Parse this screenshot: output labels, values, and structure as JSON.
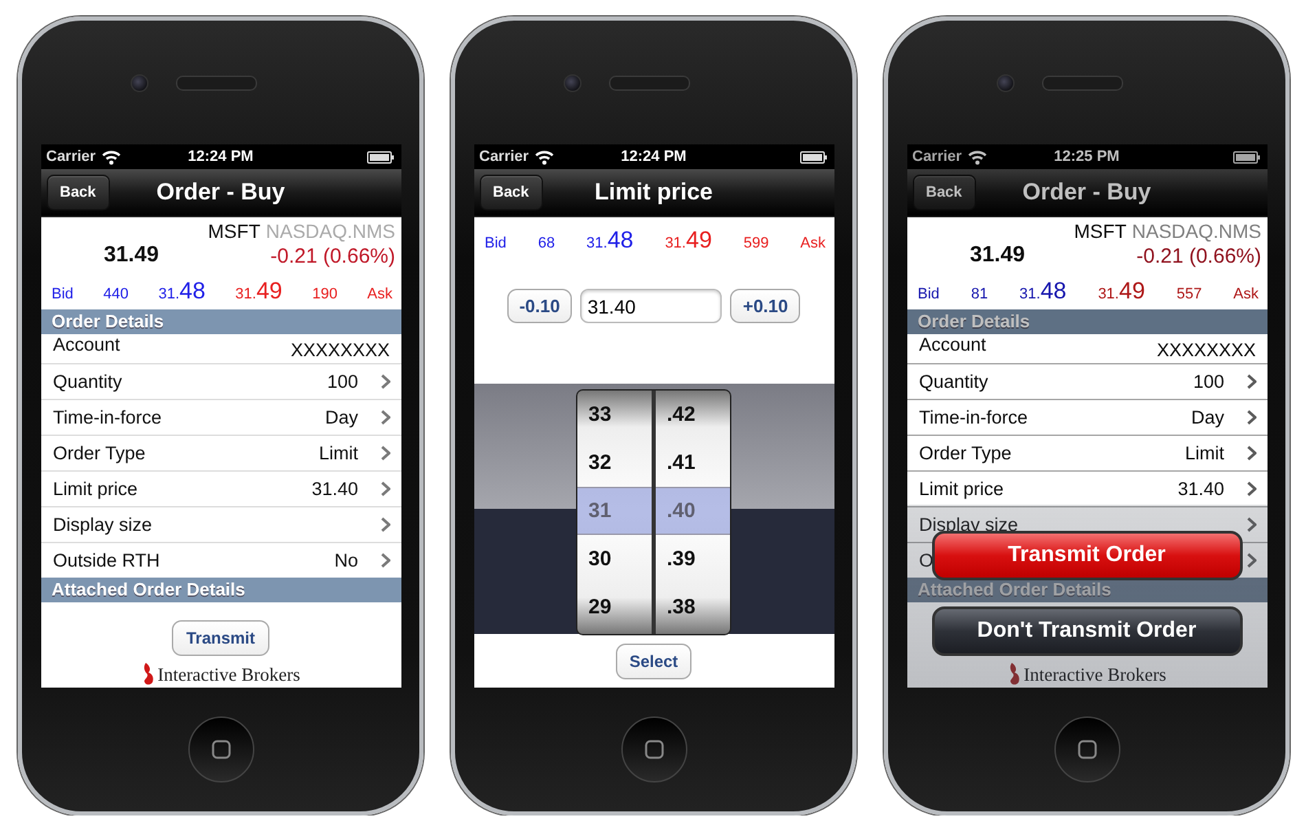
{
  "phones": [
    {
      "kind": "order",
      "dimmed": false,
      "status": {
        "carrier": "Carrier",
        "time": "12:24 PM"
      },
      "nav": {
        "back": "Back",
        "title": "Order - Buy"
      },
      "quote": {
        "symbol": "MSFT",
        "exchange": "NASDAQ.NMS",
        "last": "31.49",
        "change": "-0.21 (0.66%)",
        "bid_label": "Bid",
        "bid_size": "440",
        "bid_price": {
          "main": "31.",
          "big": "48"
        },
        "ask_price": {
          "main": "31.",
          "big": "49"
        },
        "ask_size": "190",
        "ask_label": "Ask"
      },
      "sections": [
        {
          "title": "Order Details",
          "rows": [
            {
              "label": "Account",
              "value": "XXXXXXXX",
              "disclosure": false
            },
            {
              "label": "Quantity",
              "value": "100",
              "disclosure": true
            },
            {
              "label": "Time-in-force",
              "value": "Day",
              "disclosure": true
            },
            {
              "label": "Order Type",
              "value": "Limit",
              "disclosure": true
            },
            {
              "label": "Limit price",
              "value": "31.40",
              "disclosure": true
            },
            {
              "label": "Display size",
              "disclosure": true
            },
            {
              "label": "Outside RTH",
              "value": "No",
              "disclosure": true
            }
          ]
        },
        {
          "title": "Attached Order Details"
        }
      ],
      "button": "Transmit",
      "logo": "Interactive Brokers"
    },
    {
      "kind": "picker",
      "dimmed": false,
      "status": {
        "carrier": "Carrier",
        "time": "12:24 PM"
      },
      "nav": {
        "back": "Back",
        "title": "Limit price"
      },
      "quote": {
        "bid_label": "Bid",
        "bid_size": "68",
        "bid_price": {
          "main": "31.",
          "big": "48"
        },
        "ask_price": {
          "main": "31.",
          "big": "49"
        },
        "ask_size": "599",
        "ask_label": "Ask"
      },
      "stepper": {
        "decrement": "-0.10",
        "value": "31.40",
        "increment": "+0.10"
      },
      "picker": {
        "columns": [
          {
            "items": [
              {
                "text": "33",
                "selected": false
              },
              {
                "text": "32",
                "selected": false
              },
              {
                "text": "31",
                "selected": true
              },
              {
                "text": "30",
                "selected": false
              },
              {
                "text": "29",
                "selected": false
              }
            ]
          },
          {
            "items": [
              {
                "text": ".42",
                "selected": false
              },
              {
                "text": ".41",
                "selected": false
              },
              {
                "text": ".40",
                "selected": true
              },
              {
                "text": ".39",
                "selected": false
              },
              {
                "text": ".38",
                "selected": false
              }
            ]
          }
        ]
      },
      "button": "Select"
    },
    {
      "kind": "order",
      "dimmed": true,
      "status": {
        "carrier": "Carrier",
        "time": "12:25 PM"
      },
      "nav": {
        "back": "Back",
        "title": "Order - Buy"
      },
      "quote": {
        "symbol": "MSFT",
        "exchange": "NASDAQ.NMS",
        "last": "31.49",
        "change": "-0.21 (0.66%)",
        "bid_label": "Bid",
        "bid_size": "81",
        "bid_price": {
          "main": "31.",
          "big": "48"
        },
        "ask_price": {
          "main": "31.",
          "big": "49"
        },
        "ask_size": "557",
        "ask_label": "Ask"
      },
      "sections": [
        {
          "title": "Order Details",
          "rows": [
            {
              "label": "Account",
              "value": "XXXXXXXX",
              "disclosure": false
            },
            {
              "label": "Quantity",
              "value": "100",
              "disclosure": true
            },
            {
              "label": "Time-in-force",
              "value": "Day",
              "disclosure": true
            },
            {
              "label": "Order Type",
              "value": "Limit",
              "disclosure": true
            },
            {
              "label": "Limit price",
              "value": "31.40",
              "disclosure": true
            },
            {
              "label": "Display size",
              "disclosure": true
            },
            {
              "label": "O",
              "disclosure": true
            }
          ]
        },
        {
          "title": "Attached Order Details"
        }
      ],
      "logo": "Interactive Brokers",
      "action_sheet": {
        "buttons": [
          {
            "label": "Transmit Order",
            "kind": "destructive"
          },
          {
            "label": "Don't Transmit Order",
            "kind": "cancel"
          }
        ]
      }
    }
  ]
}
